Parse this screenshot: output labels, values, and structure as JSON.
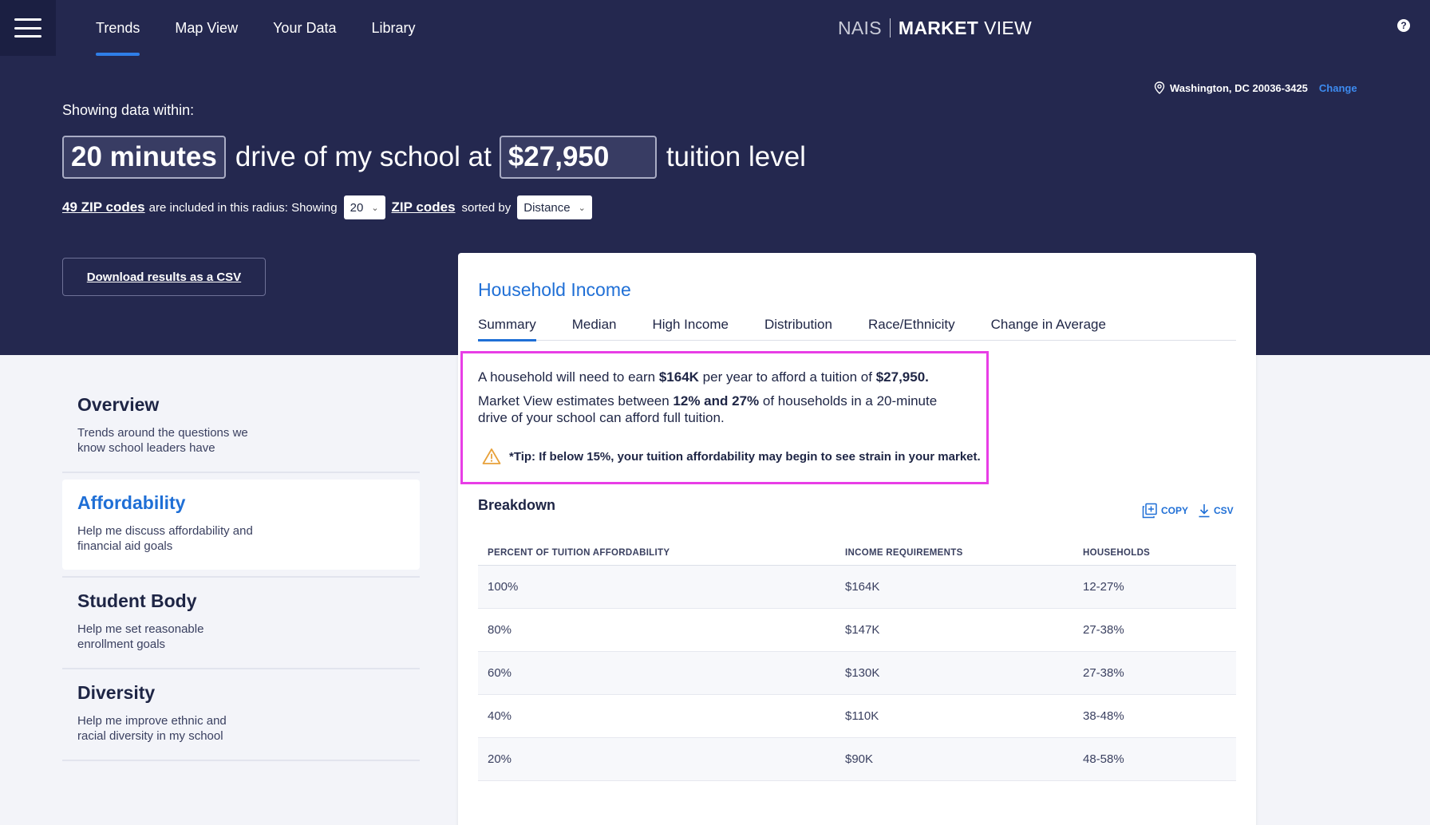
{
  "nav": {
    "tabs": [
      {
        "label": "Trends"
      },
      {
        "label": "Map View"
      },
      {
        "label": "Your Data"
      },
      {
        "label": "Library"
      }
    ],
    "active_tab": "Trends"
  },
  "brand": {
    "nais": "NAIS",
    "market": "MARKET",
    "view": "VIEW"
  },
  "help": {
    "icon": "question-icon",
    "glyph": "?"
  },
  "location": {
    "address": "Washington, DC 20036-3425",
    "change_label": "Change",
    "icon": "map-pin-icon"
  },
  "filters": {
    "showing_label": "Showing data within:",
    "drive_time": "20 minutes",
    "drive_text": "drive of my school at",
    "tuition": "$27,950",
    "tuition_text": "tuition level",
    "zip_count_link": "49 ZIP codes",
    "radius_text": "are included in this radius: Showing",
    "show_count": "20",
    "zip_codes_link": "ZIP codes",
    "sorted_by_text": "sorted by",
    "sort_value": "Distance"
  },
  "download_label": "Download results as a CSV",
  "sidebar": {
    "items": [
      {
        "title": "Overview",
        "desc": "Trends around the questions we know school leaders have"
      },
      {
        "title": "Affordability",
        "desc": "Help me discuss affordability and financial aid goals"
      },
      {
        "title": "Student Body",
        "desc": "Help me set reasonable enrollment goals"
      },
      {
        "title": "Diversity",
        "desc": "Help me improve ethnic and racial diversity in my school"
      }
    ],
    "active": "Affordability"
  },
  "card": {
    "title": "Household Income",
    "tabs": [
      {
        "label": "Summary"
      },
      {
        "label": "Median"
      },
      {
        "label": "High Income"
      },
      {
        "label": "Distribution"
      },
      {
        "label": "Race/Ethnicity"
      },
      {
        "label": "Change in Average"
      }
    ],
    "active_tab": "Summary",
    "summary": {
      "line1_a": "A household will need to earn ",
      "line1_b": "$164K",
      "line1_c": " per year to afford a tuition of ",
      "line1_d": "$27,950.",
      "line2_a": "Market View estimates between ",
      "line2_b": "12% and 27%",
      "line2_c": " of households in a 20-minute drive of your school can afford full tuition.",
      "tip": "*Tip: If below 15%, your tuition affordability may begin to see strain in your market.",
      "tip_icon": "warning-icon",
      "highlight_color": "#e83ee6"
    },
    "breakdown": {
      "title": "Breakdown",
      "copy_label": "COPY",
      "csv_label": "CSV",
      "columns": [
        "PERCENT OF TUITION AFFORDABILITY",
        "INCOME REQUIREMENTS",
        "HOUSEHOLDS"
      ],
      "rows": [
        [
          "100%",
          "$164K",
          "12-27%"
        ],
        [
          "80%",
          "$147K",
          "27-38%"
        ],
        [
          "60%",
          "$130K",
          "27-38%"
        ],
        [
          "40%",
          "$110K",
          "38-48%"
        ],
        [
          "20%",
          "$90K",
          "48-58%"
        ]
      ]
    }
  },
  "colors": {
    "navy": "#24284f",
    "accent_blue": "#1f6fd6",
    "warning": "#e8a13a"
  }
}
